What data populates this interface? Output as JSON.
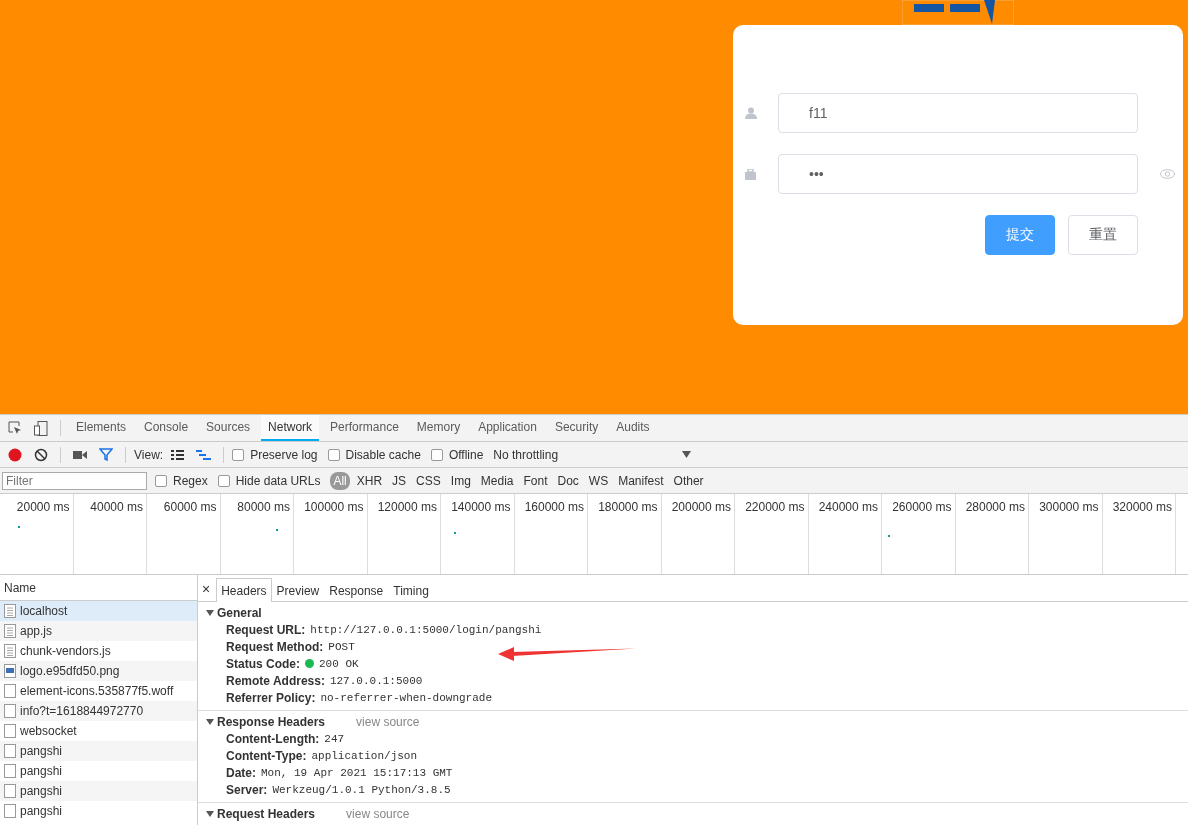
{
  "login_form": {
    "username": {
      "value": "f11"
    },
    "password": {
      "value": "•••"
    },
    "buttons": [
      {
        "label": "提交",
        "kind": "primary"
      },
      {
        "label": "重置",
        "kind": "default"
      }
    ]
  },
  "devtools": {
    "tabs": [
      {
        "label": "Elements",
        "selected": false
      },
      {
        "label": "Console",
        "selected": false
      },
      {
        "label": "Sources",
        "selected": false
      },
      {
        "label": "Network",
        "selected": true
      },
      {
        "label": "Performance",
        "selected": false
      },
      {
        "label": "Memory",
        "selected": false
      },
      {
        "label": "Application",
        "selected": false
      },
      {
        "label": "Security",
        "selected": false
      },
      {
        "label": "Audits",
        "selected": false
      }
    ],
    "toolbar": {
      "recording": true,
      "filter_active": true,
      "view_label": "View:",
      "large_rows": false,
      "waterfall": true,
      "checkboxes": [
        {
          "label": "Preserve log",
          "checked": false
        },
        {
          "label": "Disable cache",
          "checked": false
        },
        {
          "label": "Offline",
          "checked": false
        }
      ],
      "throttling": "No throttling"
    },
    "filter_bar": {
      "placeholder": "Filter",
      "checkboxes": [
        {
          "label": "Regex",
          "checked": false
        },
        {
          "label": "Hide data URLs",
          "checked": false
        }
      ],
      "types": [
        {
          "label": "All",
          "selected": true
        },
        {
          "label": "XHR",
          "selected": false
        },
        {
          "label": "JS",
          "selected": false
        },
        {
          "label": "CSS",
          "selected": false
        },
        {
          "label": "Img",
          "selected": false
        },
        {
          "label": "Media",
          "selected": false
        },
        {
          "label": "Font",
          "selected": false
        },
        {
          "label": "Doc",
          "selected": false
        },
        {
          "label": "WS",
          "selected": false
        },
        {
          "label": "Manifest",
          "selected": false
        },
        {
          "label": "Other",
          "selected": false
        }
      ]
    },
    "timeline_ticks": [
      "20000 ms",
      "40000 ms",
      "60000 ms",
      "80000 ms",
      "100000 ms",
      "120000 ms",
      "140000 ms",
      "160000 ms",
      "180000 ms",
      "200000 ms",
      "220000 ms",
      "240000 ms",
      "260000 ms",
      "280000 ms",
      "300000 ms",
      "320000 ms"
    ],
    "requests": {
      "column": "Name",
      "rows": [
        {
          "name": "localhost",
          "kind": "text",
          "selected": true
        },
        {
          "name": "app.js",
          "kind": "text",
          "selected": false
        },
        {
          "name": "chunk-vendors.js",
          "kind": "text",
          "selected": false
        },
        {
          "name": "logo.e95dfd50.png",
          "kind": "image",
          "selected": false
        },
        {
          "name": "element-icons.535877f5.woff",
          "kind": "blank",
          "selected": false
        },
        {
          "name": "info?t=1618844972770",
          "kind": "blank",
          "selected": false
        },
        {
          "name": "websocket",
          "kind": "blank",
          "selected": false
        },
        {
          "name": "pangshi",
          "kind": "blank",
          "selected": false
        },
        {
          "name": "pangshi",
          "kind": "blank",
          "selected": false
        },
        {
          "name": "pangshi",
          "kind": "blank",
          "selected": false
        },
        {
          "name": "pangshi",
          "kind": "blank",
          "selected": false
        }
      ]
    },
    "details": {
      "close": "×",
      "tabs": [
        {
          "label": "Headers",
          "selected": true
        },
        {
          "label": "Preview",
          "selected": false
        },
        {
          "label": "Response",
          "selected": false
        },
        {
          "label": "Timing",
          "selected": false
        }
      ],
      "sections": [
        {
          "title": "General",
          "expanded": true,
          "rows": [
            {
              "key": "Request URL:",
              "value": "http://127.0.0.1:5000/login/pangshi"
            },
            {
              "key": "Request Method:",
              "value": "POST"
            },
            {
              "key": "Status Code:",
              "value": "200 OK",
              "color": "#1db954"
            },
            {
              "key": "Remote Address:",
              "value": "127.0.0.1:5000"
            },
            {
              "key": "Referrer Policy:",
              "value": "no-referrer-when-downgrade"
            }
          ]
        },
        {
          "title": "Response Headers",
          "expanded": true,
          "link": "view source",
          "rows": [
            {
              "key": "Content-Length:",
              "value": "247"
            },
            {
              "key": "Content-Type:",
              "value": "application/json"
            },
            {
              "key": "Date:",
              "value": "Mon, 19 Apr 2021 15:17:13 GMT"
            },
            {
              "key": "Server:",
              "value": "Werkzeug/1.0.1 Python/3.8.5"
            }
          ]
        },
        {
          "title": "Request Headers",
          "expanded": true,
          "link": "view source"
        }
      ]
    }
  }
}
